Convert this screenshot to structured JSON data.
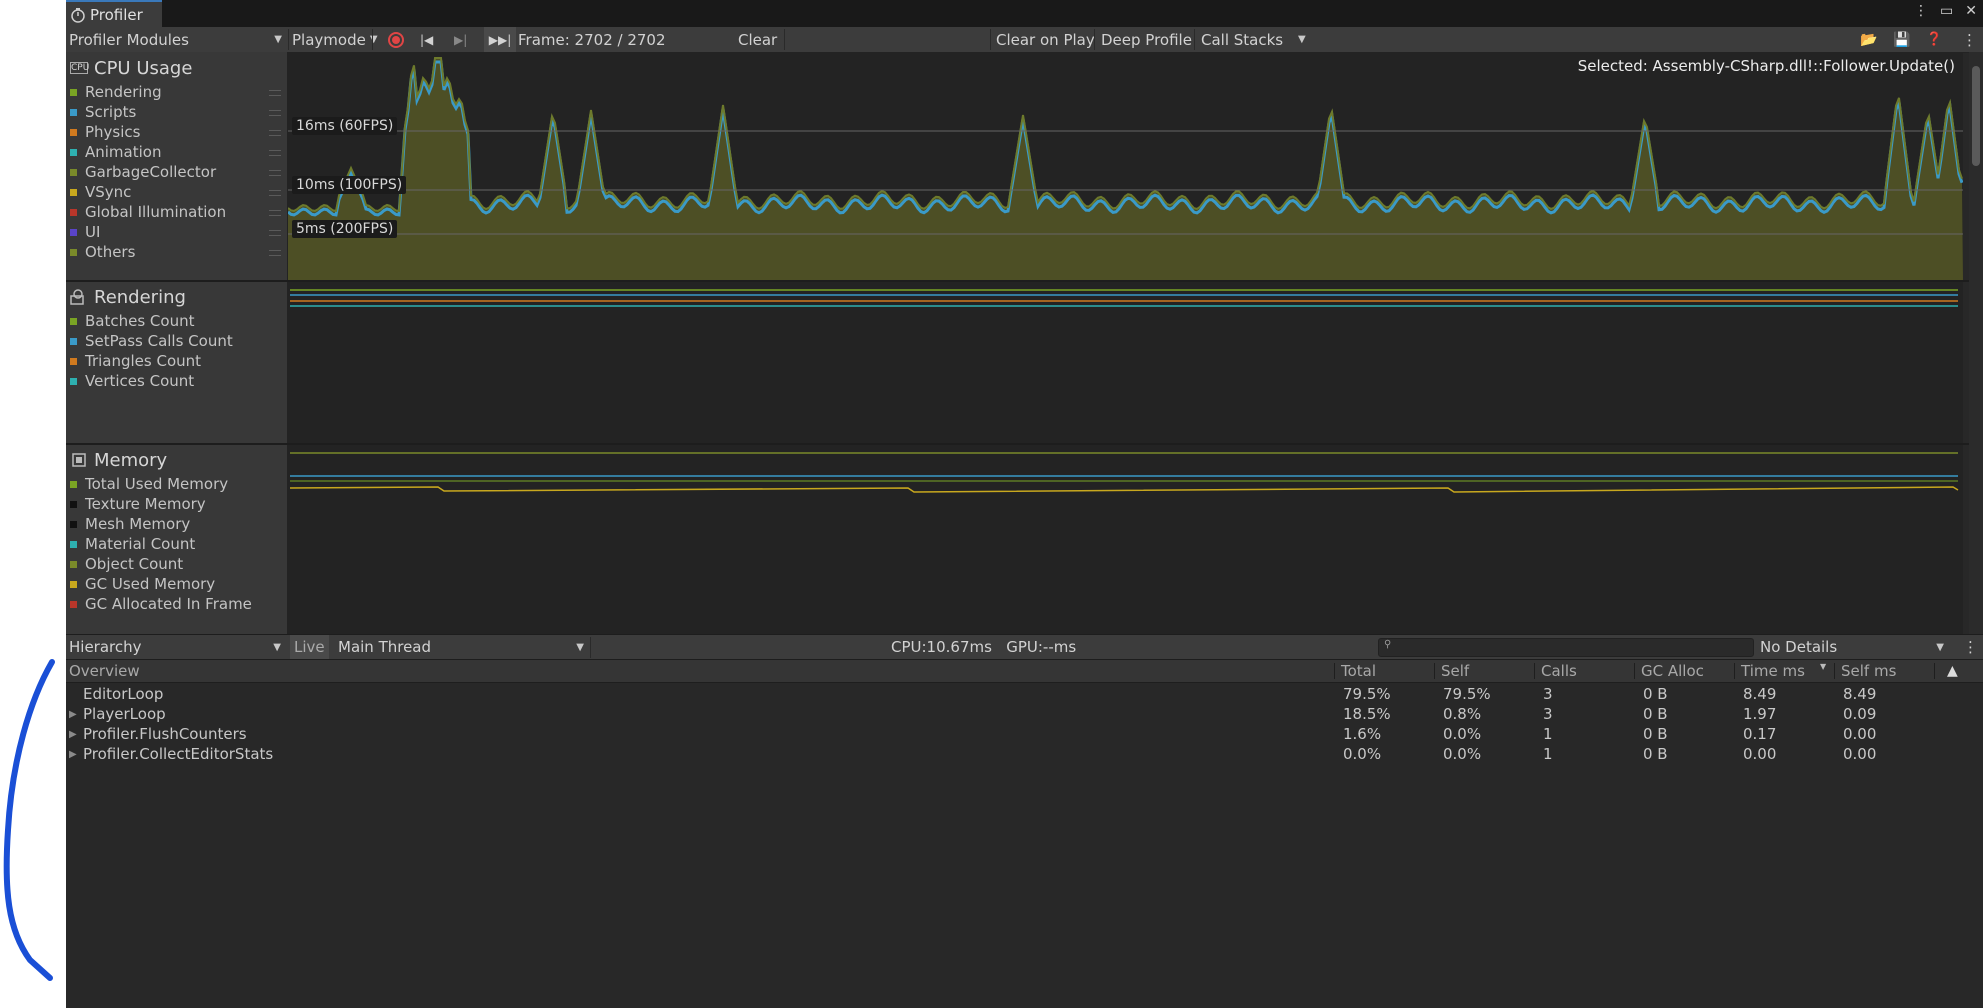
{
  "window": {
    "tab_title": "Profiler",
    "title_icons": [
      "kebab-icon",
      "maximize-icon",
      "close-icon"
    ]
  },
  "toolbar": {
    "modules_dropdown": "Profiler Modules",
    "playmode_dropdown": "Playmode",
    "frame_label": "Frame: 2702 / 2702",
    "clear": "Clear",
    "clear_on_play": "Clear on Play",
    "deep_profile": "Deep Profile",
    "call_stacks": "Call Stacks"
  },
  "cpu": {
    "title": "CPU Usage",
    "selected": "Selected: Assembly-CSharp.dll!::Follower.Update()",
    "legend": [
      {
        "label": "Rendering",
        "color": "#7aa424"
      },
      {
        "label": "Scripts",
        "color": "#3a9ac8"
      },
      {
        "label": "Physics",
        "color": "#d07a1f"
      },
      {
        "label": "Animation",
        "color": "#2eb0b0"
      },
      {
        "label": "GarbageCollector",
        "color": "#7a8a2a"
      },
      {
        "label": "VSync",
        "color": "#c8a81e"
      },
      {
        "label": "Global Illumination",
        "color": "#b8362a"
      },
      {
        "label": "UI",
        "color": "#5a44c8"
      },
      {
        "label": "Others",
        "color": "#7a8a2a"
      }
    ],
    "markers": [
      "16ms (60FPS)",
      "10ms (100FPS)",
      "5ms (200FPS)"
    ]
  },
  "rendering": {
    "title": "Rendering",
    "legend": [
      {
        "label": "Batches Count",
        "color": "#7aa424"
      },
      {
        "label": "SetPass Calls Count",
        "color": "#3a9ac8"
      },
      {
        "label": "Triangles Count",
        "color": "#d07a1f"
      },
      {
        "label": "Vertices Count",
        "color": "#2eb0b0"
      }
    ]
  },
  "memory": {
    "title": "Memory",
    "legend": [
      {
        "label": "Total Used Memory",
        "color": "#7aa424"
      },
      {
        "label": "Texture Memory",
        "color": "#111111"
      },
      {
        "label": "Mesh Memory",
        "color": "#111111"
      },
      {
        "label": "Material Count",
        "color": "#2eb0b0"
      },
      {
        "label": "Object Count",
        "color": "#7a8a2a"
      },
      {
        "label": "GC Used Memory",
        "color": "#c8a81e"
      },
      {
        "label": "GC Allocated In Frame",
        "color": "#b8362a"
      }
    ]
  },
  "hierarchy_toolbar": {
    "view_dropdown": "Hierarchy",
    "live": "Live",
    "thread_dropdown": "Main Thread",
    "cpu_gpu": "CPU:10.67ms   GPU:--ms",
    "details_dropdown": "No Details"
  },
  "table": {
    "columns": [
      "Overview",
      "Total",
      "Self",
      "Calls",
      "GC Alloc",
      "Time ms",
      "Self ms"
    ],
    "rows": [
      {
        "name": "EditorLoop",
        "expandable": false,
        "total": "79.5%",
        "self": "79.5%",
        "calls": "3",
        "gc": "0 B",
        "time": "8.49",
        "selfms": "8.49"
      },
      {
        "name": "PlayerLoop",
        "expandable": true,
        "total": "18.5%",
        "self": "0.8%",
        "calls": "3",
        "gc": "0 B",
        "time": "1.97",
        "selfms": "0.09"
      },
      {
        "name": "Profiler.FlushCounters",
        "expandable": true,
        "total": "1.6%",
        "self": "0.0%",
        "calls": "1",
        "gc": "0 B",
        "time": "0.17",
        "selfms": "0.00"
      },
      {
        "name": "Profiler.CollectEditorStats",
        "expandable": true,
        "total": "0.0%",
        "self": "0.0%",
        "calls": "1",
        "gc": "0 B",
        "time": "0.00",
        "selfms": "0.00"
      }
    ]
  },
  "colors": {
    "cpu_fill": "#4d4f25",
    "scripts_line": "#3a9ac8",
    "annotation_stroke": "#1a4fd6"
  }
}
